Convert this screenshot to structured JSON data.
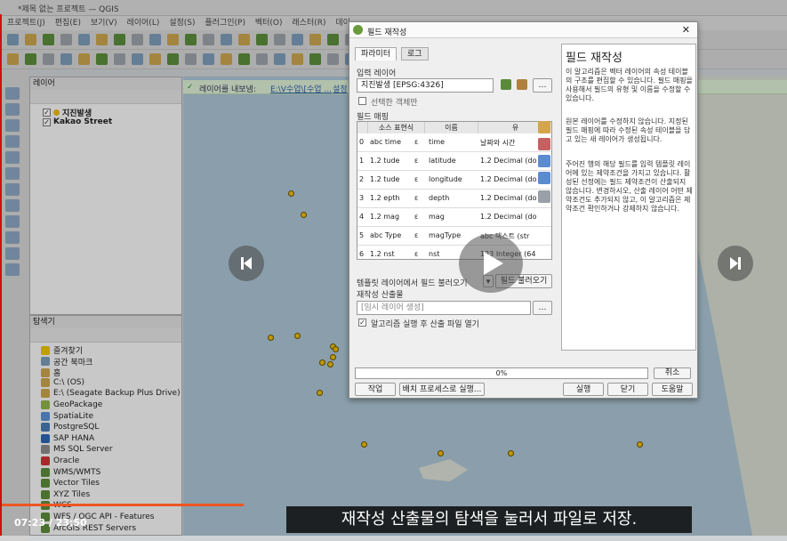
{
  "app": {
    "title": "*제목 없는 프로젝트 — QGIS"
  },
  "menu": [
    "프로젝트(J)",
    "편집(E)",
    "보기(V)",
    "레이어(L)",
    "설정(S)",
    "플러그인(P)",
    "벡터(O)",
    "래스터(R)",
    "데이"
  ],
  "layers_panel": {
    "title": "레이어",
    "layers": [
      {
        "name": "지진발생",
        "checked": true
      },
      {
        "name": "Kakao Street",
        "checked": true
      }
    ]
  },
  "browser_panel": {
    "title": "탐색기",
    "items": [
      "즐겨찾기",
      "공간 북마크",
      "홈",
      "C:\\ (OS)",
      "E:\\ (Seagate Backup Plus Drive)",
      "GeoPackage",
      "SpatiaLite",
      "PostgreSQL",
      "SAP HANA",
      "MS SQL Server",
      "Oracle",
      "WMS/WMTS",
      "Vector Tiles",
      "XYZ Tiles",
      "WCS",
      "WFS / OGC API - Features",
      "ArcGIS REST Servers"
    ]
  },
  "message_bar": {
    "prefix": "레이어를 내보냄:",
    "link": "E:\\V수업\\[수업 ...",
    "link2": "설정"
  },
  "dialog": {
    "title": "필드 재작성",
    "tabs": [
      "파라미터",
      "로그"
    ],
    "input_label": "입력 레이어",
    "input_value": "지진발생 [EPSG:4326]",
    "selected_only": "선택한 객체만",
    "mapping_label": "필드 매핑",
    "columns": [
      "소스 표현식",
      "이름",
      "유"
    ],
    "rows": [
      {
        "idx": "0",
        "src": "abc time",
        "name": "time",
        "type": "날짜와 시간"
      },
      {
        "idx": "1",
        "src": "1.2 tude",
        "name": "latitude",
        "type": "1.2 Decimal (do"
      },
      {
        "idx": "2",
        "src": "1.2 tude",
        "name": "longitude",
        "type": "1.2 Decimal (do"
      },
      {
        "idx": "3",
        "src": "1.2 epth",
        "name": "depth",
        "type": "1.2 Decimal (do"
      },
      {
        "idx": "4",
        "src": "1.2 mag",
        "name": "mag",
        "type": "1.2 Decimal (do"
      },
      {
        "idx": "5",
        "src": "abc Type",
        "name": "magType",
        "type": "abc 텍스트 (str"
      },
      {
        "idx": "6",
        "src": "1.2 nst",
        "name": "nst",
        "type": "123 Integer (64"
      }
    ],
    "load_fields_label": "템플릿 레이어에서 필드 불러오기",
    "load_button": "필드 불러오기",
    "output_label": "재작성 산출물",
    "output_placeholder": "[임시 레이어 생성]",
    "open_after": "알고리즘 실행 후 산출 파일 열기",
    "progress": "0%",
    "cancel": "취소",
    "advanced": "작업",
    "batch": "배치 프로세스로 실행...",
    "run": "실행",
    "close": "닫기",
    "help_button": "도움말",
    "help_title": "필드 재작성",
    "help_p1": "이 알고리즘은 벡터 레이어의 속성 테이블의 구조를 편집할 수 있습니다. 필드 매핑을 사용해서 필드의 유형 및 이름을 수정할 수 있습니다.",
    "help_p2": "원본 레이어를 수정하지 않습니다. 지정된 필드 매핑에 따라 수정된 속성 테이블을 담고 있는 새 레이어가 생성됩니다.",
    "help_p3": "주어진 행의 해당 필드를 입력 템플릿 레이어에 있는 제약조건을 가지고 있습니다. 활성된 선정에는 필드 제약조건이 산출되지 않습니다. 변경하시오, 산출 레이어 어떤 제약조건도 추가되지 않고, 이 알고리즘은 제약조건 확인하거나 강제하지 않습니다."
  },
  "video": {
    "time": "07:23 / 23:50",
    "subtitle": "재작성 산출물의 탐색을 눌러서 파일로 저장.",
    "progress_fraction": 0.31
  },
  "colors": {
    "accent": "#e8b90d",
    "timebar": "#e52222"
  }
}
